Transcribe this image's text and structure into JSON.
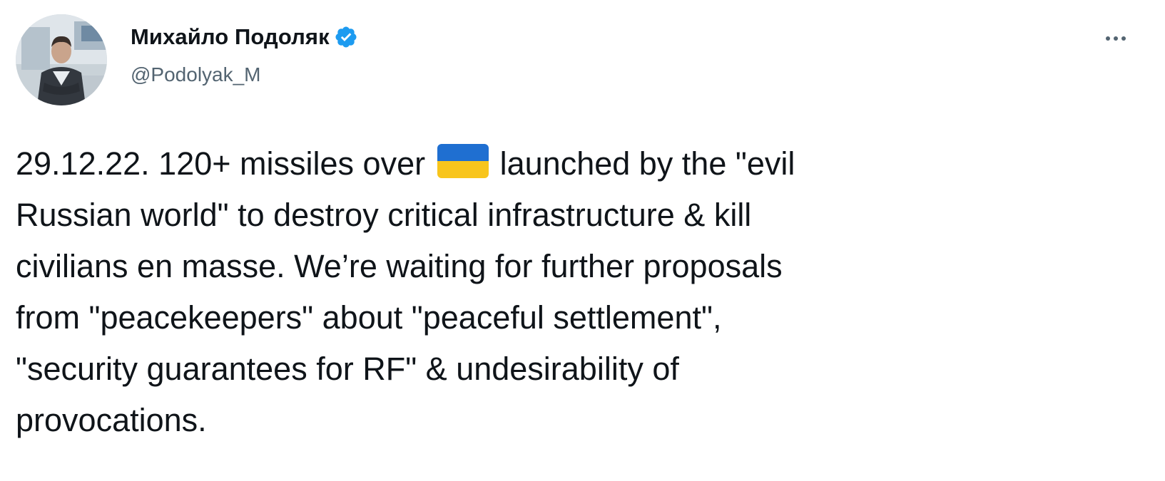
{
  "author": {
    "display_name": "Михайло Подоляк",
    "handle": "@Podolyak_M",
    "verified": true,
    "avatar": "profile-photo"
  },
  "tweet": {
    "line_1_before_flag": "29.12.22. 120+ missiles over",
    "flag_emoji": "ukraine-flag",
    "line_1_after_flag": "launched by the \"evil",
    "line_2": "Russian world\" to destroy critical infrastructure & kill",
    "line_3": "civilians en masse. We’re waiting for further proposals",
    "line_4": "from \"peacekeepers\" about \"peaceful settlement\",",
    "line_5": "\"security guarantees for RF\" & undesirability of",
    "line_6": "provocations."
  },
  "icons": {
    "verified": "verified-badge-icon",
    "more": "more-options-icon"
  },
  "colors": {
    "verified_blue": "#1d9bf0",
    "text_primary": "#0f1419",
    "text_secondary": "#536471",
    "flag_blue": "#1f6fd1",
    "flag_yellow": "#f8c51c"
  }
}
